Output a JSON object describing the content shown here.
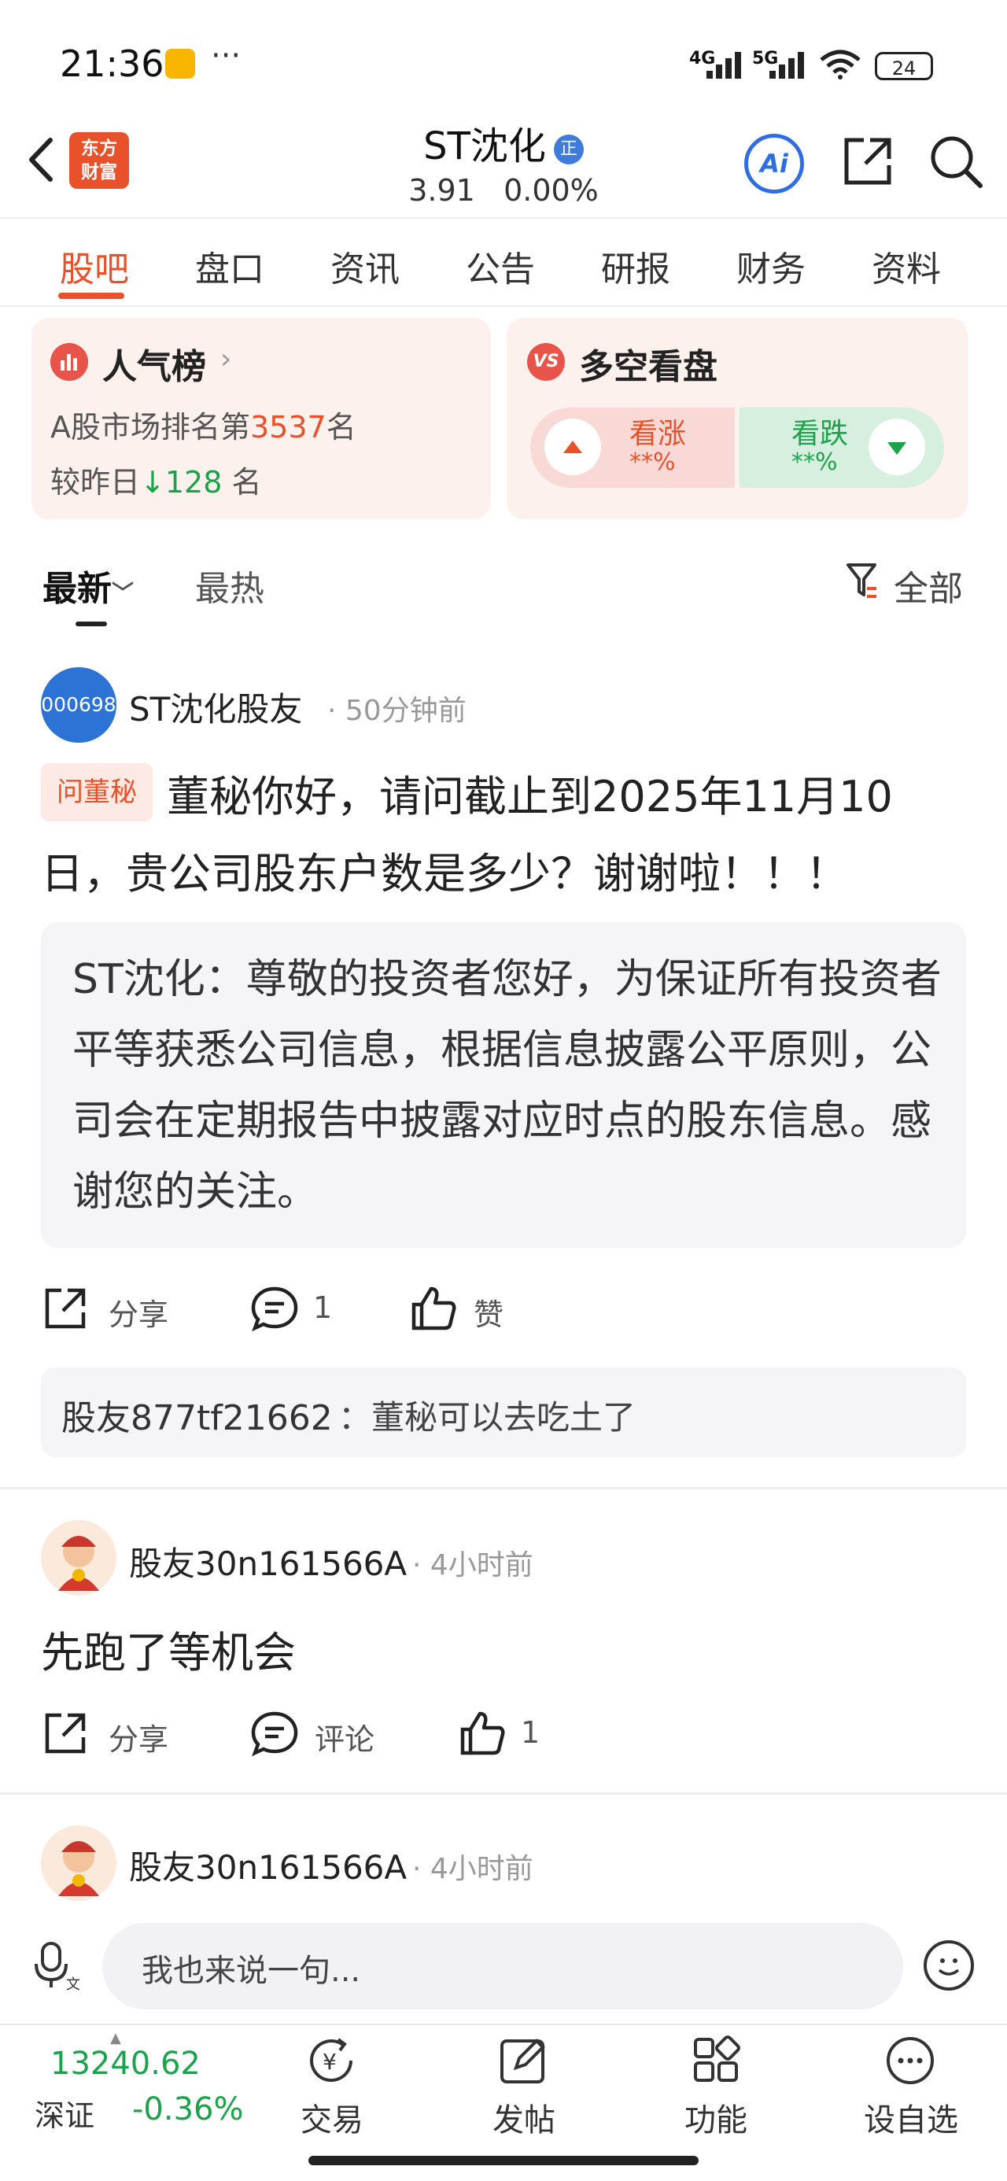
{
  "status_bar": {
    "time": "21:36",
    "dots": "···",
    "net1": "4G",
    "net2": "5G",
    "battery": "24"
  },
  "header": {
    "logo_line1": "东方",
    "logo_line2": "财富",
    "stock_name": "ST沈化",
    "badge": "正",
    "price": "3.91",
    "change": "0.00%",
    "ai_label": "Ai"
  },
  "tabs": [
    "股吧",
    "盘口",
    "资讯",
    "公告",
    "研报",
    "财务",
    "资料"
  ],
  "popularity_card": {
    "title": "人气榜",
    "rank_prefix": "A股市场排名第",
    "rank": "3537",
    "rank_suffix": "名",
    "diff_prefix": "较昨日",
    "diff_value": "128",
    "diff_suffix": " 名"
  },
  "bull_bear_card": {
    "icon_text": "VS",
    "title": "多空看盘",
    "bull_label": "看涨",
    "bull_pct": "**%",
    "bear_label": "看跌",
    "bear_pct": "**%"
  },
  "sort": {
    "newest": "最新",
    "hottest": "最热",
    "filter": "全部"
  },
  "posts": [
    {
      "avatar_text": "000698",
      "user": "ST沈化股友",
      "time": "· 50分钟前",
      "tag": "问董秘",
      "text": "董秘你好，请问截止到2025年11月10日，贵公司股东户数是多少？谢谢啦！！！",
      "reply": "ST沈化：尊敬的投资者您好，为保证所有投资者平等获悉公司信息，根据信息披露公平原则，公司会在定期报告中披露对应时点的股东信息。感谢您的关注。",
      "share": "分享",
      "comments": "1",
      "likes": "赞",
      "comment_user": "股友877tf21662",
      "comment_text": "：董秘可以去吃土了"
    },
    {
      "user": "股友30n161566A",
      "time": "· 4小时前",
      "text": "先跑了等机会",
      "share": "分享",
      "comments": "评论",
      "likes": "1"
    },
    {
      "user": "股友30n161566A",
      "time": "· 4小时前"
    }
  ],
  "input": {
    "placeholder": "我也来说一句..."
  },
  "bottom_nav": {
    "index_value": "13240.62",
    "index_name": "深证",
    "index_change": "-0.36%",
    "items": [
      "交易",
      "发帖",
      "功能",
      "设自选"
    ]
  },
  "colors": {
    "accent": "#e8512a",
    "up_green": "#1aa34a",
    "link_blue": "#2f6ee0"
  }
}
